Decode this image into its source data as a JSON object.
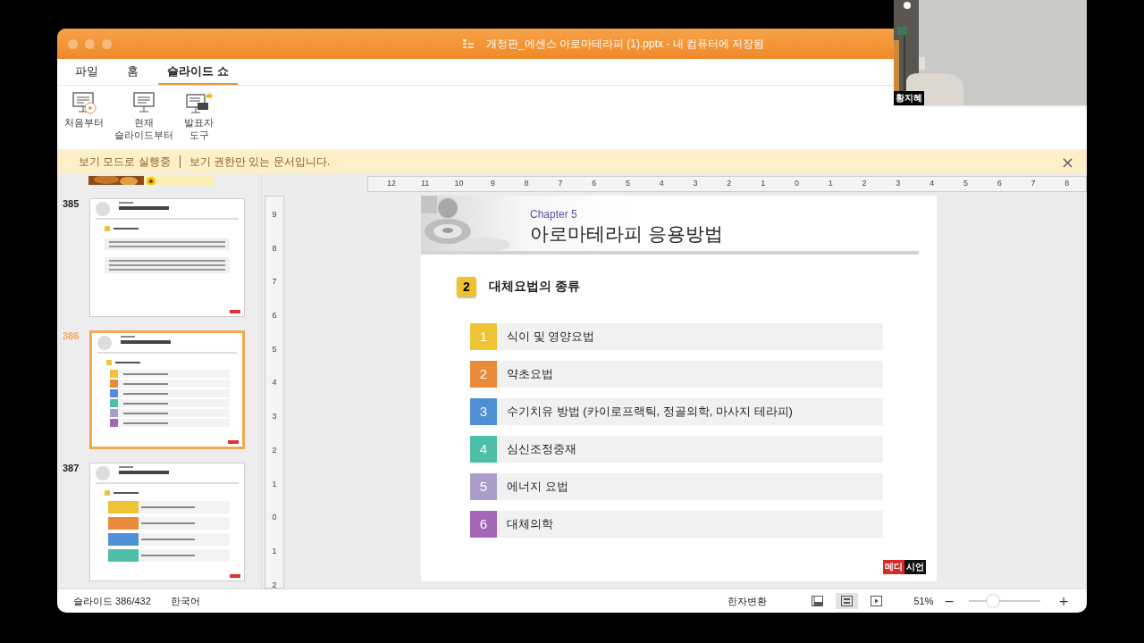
{
  "webcam": {
    "name": "황지혜"
  },
  "window": {
    "title": "개정판_에센스 아로마테라피 (1).pptx - 내 컴퓨터에 저장됨"
  },
  "tabs": [
    {
      "label": "파일",
      "selected": false
    },
    {
      "label": "홈",
      "selected": false
    },
    {
      "label": "슬라이드 쇼",
      "selected": true
    }
  ],
  "ribbon": [
    {
      "kind": "play",
      "label": "처음부터"
    },
    {
      "kind": "plain",
      "label": "현재\n슬라이드부터"
    },
    {
      "kind": "presenter",
      "label": "발표자\n도구"
    }
  ],
  "infobar": {
    "mode": "보기 모드로 실행중",
    "message": "보기 권한만 있는 문서입니다.",
    "close": "×"
  },
  "thumbnails": [
    {
      "number": "385",
      "kind": "text",
      "selected": false
    },
    {
      "number": "386",
      "kind": "list",
      "selected": true
    },
    {
      "number": "387",
      "kind": "table",
      "selected": false
    }
  ],
  "ruler": {
    "horizontal": [
      "12",
      "11",
      "10",
      "9",
      "8",
      "7",
      "6",
      "5",
      "4",
      "3",
      "2",
      "1",
      "0",
      "1",
      "2",
      "3",
      "4",
      "5",
      "6",
      "7",
      "8"
    ],
    "vertical": [
      "9",
      "8",
      "7",
      "6",
      "5",
      "4",
      "3",
      "2",
      "1",
      "0",
      "1",
      "2"
    ]
  },
  "slide": {
    "chapter": "Chapter 5",
    "title": "아로마테라피 응용방법",
    "section": {
      "number": "2",
      "title": "대체요법의 종류"
    },
    "items": [
      {
        "number": "1",
        "text": "식이 및 영양요법",
        "color": "#eec334"
      },
      {
        "number": "2",
        "text": "약초요법",
        "color": "#e98a3a"
      },
      {
        "number": "3",
        "text": "수기치유 방법 (카이로프랙틱, 정골의학, 마사지 테라피)",
        "color": "#4f8fd6"
      },
      {
        "number": "4",
        "text": "심신조정중재",
        "color": "#4dbfa8"
      },
      {
        "number": "5",
        "text": "에너지 요법",
        "color": "#ab9dc9"
      },
      {
        "number": "6",
        "text": "대체의학",
        "color": "#a467b8"
      }
    ],
    "logo": [
      "메디",
      "시언"
    ]
  },
  "status_bar": {
    "slide": "슬라이드 386/432",
    "language": "한국어",
    "hanja": "한자변환",
    "views": [
      {
        "kind": "normal",
        "selected": false
      },
      {
        "kind": "sorter",
        "selected": true
      },
      {
        "kind": "show",
        "selected": false
      }
    ],
    "zoom": "51%",
    "zoom_level": {
      "level": 0.33
    },
    "minus": "−",
    "plus": "+"
  }
}
